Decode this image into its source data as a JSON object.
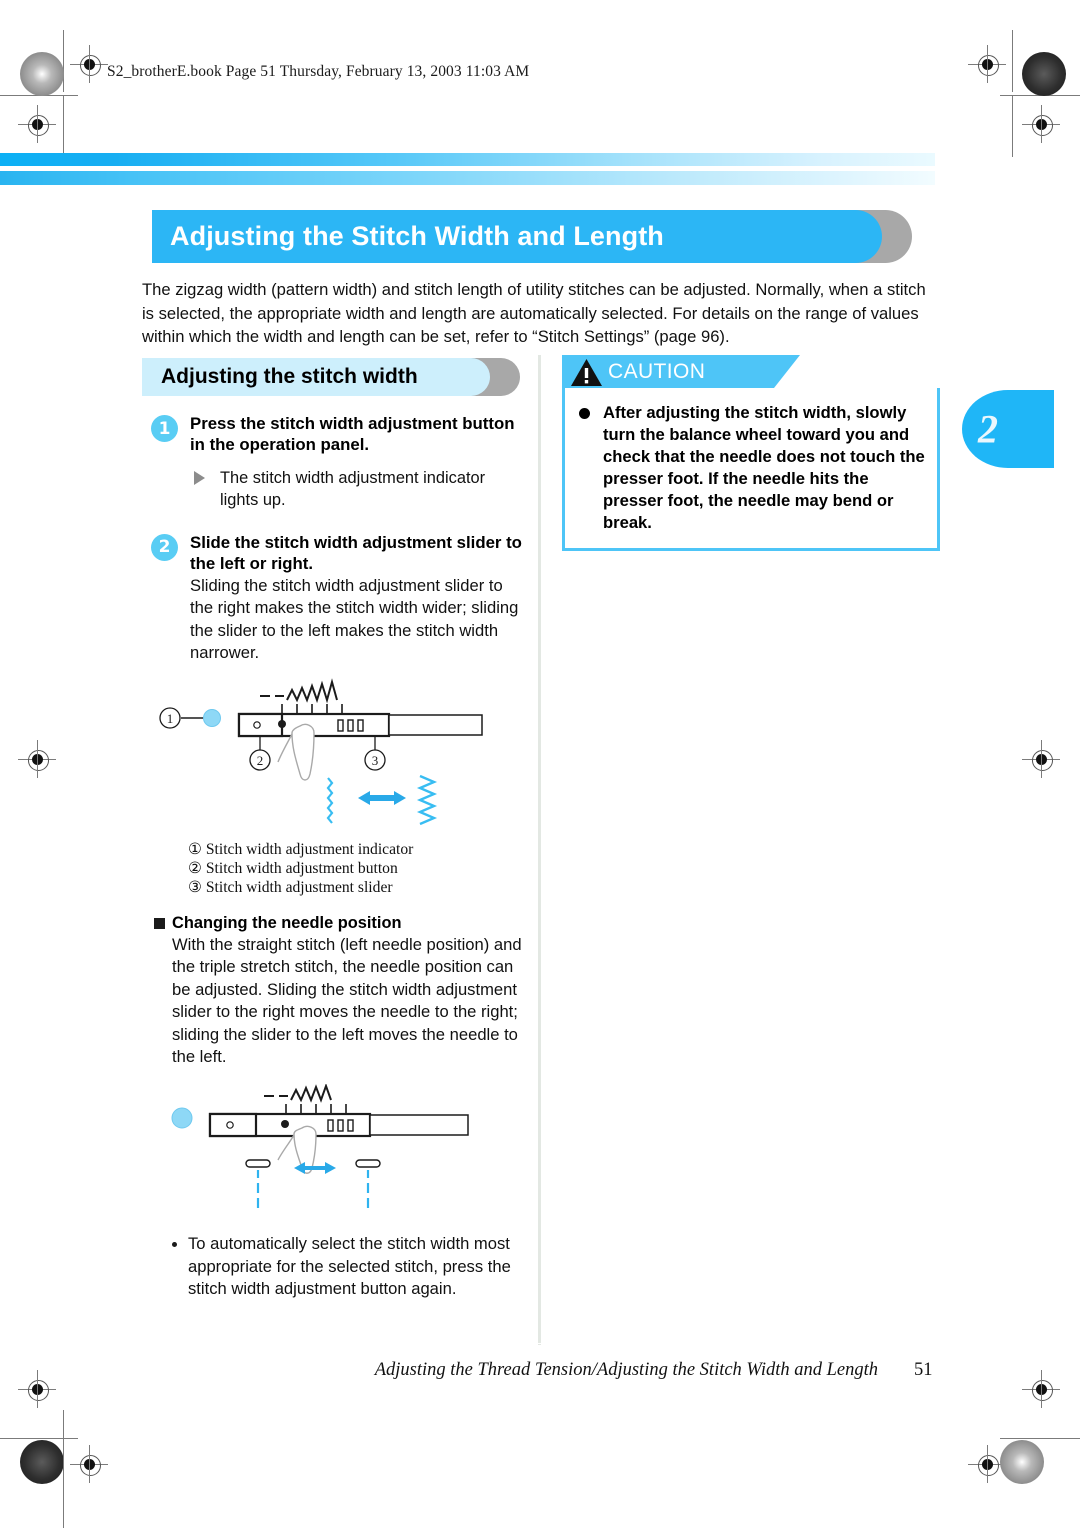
{
  "header": {
    "book_line": "S2_brotherE.book  Page 51  Thursday, February 13, 2003  11:03 AM"
  },
  "title": {
    "main": "Adjusting the Stitch Width and Length",
    "intro": "The zigzag width (pattern width) and stitch length of utility stitches can be adjusted. Normally, when a stitch is selected, the appropriate width and length are automatically selected. For details on the range of values within which the width and length can be set, refer to “Stitch Settings” (page 96)."
  },
  "chapter": {
    "number": "2"
  },
  "left_column": {
    "subheading": "Adjusting the stitch width",
    "steps": [
      {
        "num": "1",
        "heading": "Press the stitch width adjustment button in the operation panel.",
        "result": "The stitch width adjustment indicator lights up."
      },
      {
        "num": "2",
        "heading": "Slide the stitch width adjustment slider to the left or right.",
        "body": "Sliding the stitch width adjustment slider to the right makes the stitch width wider; sliding the slider to the left makes the stitch width narrower."
      }
    ],
    "legend": [
      "① Stitch width adjustment indicator",
      "② Stitch width adjustment button",
      "③ Stitch width adjustment slider"
    ],
    "needle_section": {
      "heading": "Changing the needle position",
      "body": "With the straight stitch (left needle position) and the triple stretch stitch, the needle position can be adjusted. Sliding the stitch width adjustment slider to the right moves the needle to the right; sliding the slider to the left moves the needle to the left."
    },
    "note": "To automatically select the stitch width most appropriate for the selected stitch, press the stitch width adjustment button again."
  },
  "caution": {
    "label": "CAUTION",
    "text": "After adjusting the stitch width, slowly turn the balance wheel toward you and check that the needle does not touch the presser foot. If the needle hits the presser foot, the needle may bend or break.",
    "icon": "warning-triangle-icon"
  },
  "footer": {
    "text": "Adjusting the Thread Tension/Adjusting the Stitch Width and Length",
    "page": "51"
  },
  "colors": {
    "accent_blue": "#2cb6f5",
    "light_blue": "#cdeffc",
    "caution_blue": "#4ec5f7",
    "step_circle": "#59cdf4",
    "shadow_gray": "#a8a8a8"
  }
}
